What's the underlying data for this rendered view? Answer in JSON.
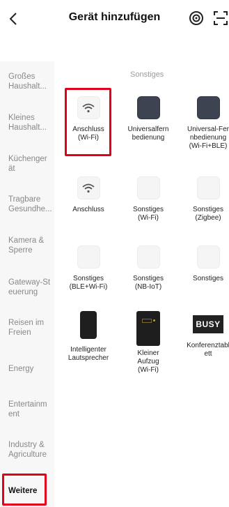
{
  "header": {
    "title": "Gerät hinzufügen"
  },
  "sidebar": {
    "items": [
      {
        "line1": "Großes",
        "line2": "Haushalt..."
      },
      {
        "line1": "Kleines",
        "line2": "Haushalt..."
      },
      {
        "line1": "Küchenger",
        "line2": "ät"
      },
      {
        "line1": "Tragbare",
        "line2": "Gesundhe..."
      },
      {
        "line1": "Kamera &",
        "line2": "Sperre"
      },
      {
        "line1": "Gateway-St",
        "line2": "euerung"
      },
      {
        "line1": "Reisen im",
        "line2": "Freien"
      },
      {
        "line1": "Energy",
        "line2": ""
      },
      {
        "line1": "Entertainm",
        "line2": "ent"
      },
      {
        "line1": "Industry &",
        "line2": "Agriculture"
      },
      {
        "line1": "Weitere",
        "line2": ""
      }
    ],
    "active": "Weitere"
  },
  "section": {
    "title": "Sonstiges"
  },
  "tiles": [
    {
      "label": "Anschluss\n(Wi-Fi)",
      "icon": "wifi-icon"
    },
    {
      "label": "Universalfern\nbedienung",
      "icon": "remote-dark-icon"
    },
    {
      "label": "Universal-Fer\nnbedienung\n(Wi-Fi+BLE)",
      "icon": "remote-dark-icon"
    },
    {
      "label": "Anschluss",
      "icon": "wifi-icon"
    },
    {
      "label": "Sonstiges\n(Wi-Fi)",
      "icon": "blank-device-icon"
    },
    {
      "label": "Sonstiges\n(Zigbee)",
      "icon": "blank-device-icon"
    },
    {
      "label": "Sonstiges\n(BLE+Wi-Fi)",
      "icon": "blank-device-icon"
    },
    {
      "label": "Sonstiges\n(NB-IoT)",
      "icon": "blank-device-icon"
    },
    {
      "label": "Sonstiges",
      "icon": "blank-device-icon"
    },
    {
      "label": "Intelligenter\nLautsprecher",
      "icon": "speaker-icon"
    },
    {
      "label": "Kleiner\nAufzug\n(Wi-Fi)",
      "icon": "elevator-icon"
    },
    {
      "label": "Konferenztabl\nett",
      "icon": "busy-sign-icon",
      "icon_text": "BUSY"
    }
  ],
  "colors": {
    "highlight": "#e3001b",
    "dark_tile": "#3d4350",
    "sidebar_bg": "#f7f7f7"
  }
}
